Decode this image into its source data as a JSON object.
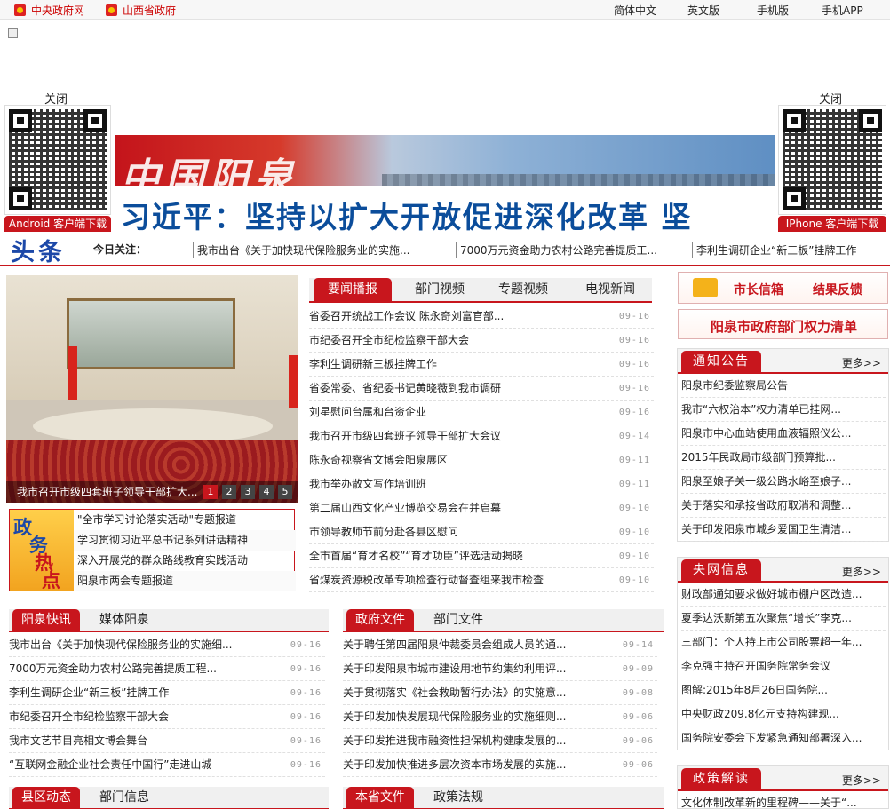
{
  "topbar": {
    "left_links": [
      "中央政府网",
      "山西省政府"
    ],
    "right_links": [
      "简体中文",
      "英文版",
      "手机版",
      "手机APP"
    ]
  },
  "float": {
    "close_left": "关闭",
    "close_right": "关闭",
    "android_label": "Android 客户端下载",
    "iphone_label": "IPhone 客户端下载"
  },
  "banner": {
    "logo": "中国阳泉",
    "headline": "习近平：坚持以扩大开放促进深化改革 坚"
  },
  "ticker": {
    "brand": "头条",
    "today_label": "今日关注：",
    "items": [
      "我市出台《关于加快现代保险服务业的实施...",
      "7000万元资金助力农村公路完善提质工...",
      "李利生调研企业“新三板”挂牌工作"
    ]
  },
  "slider": {
    "caption": "我市召开市级四套班子领导干部扩大...",
    "dots": [
      "1",
      "2",
      "3",
      "4",
      "5"
    ],
    "active": 0
  },
  "hot": {
    "badge": [
      "政",
      "务",
      "热",
      "点"
    ],
    "items": [
      "\"全市学习讨论落实活动\"专题报道",
      "学习贯彻习近平总书记系列讲话精神",
      "深入开展党的群众路线教育实践活动",
      "阳泉市两会专题报道"
    ]
  },
  "news": {
    "tabs": [
      "要闻播报",
      "部门视频",
      "专题视频",
      "电视新闻"
    ],
    "active": 0,
    "items": [
      {
        "title": "省委召开统战工作会议 陈永奇刘富官部...",
        "date": "09-16"
      },
      {
        "title": "市纪委召开全市纪检监察干部大会",
        "date": "09-16"
      },
      {
        "title": "李利生调研新三板挂牌工作",
        "date": "09-16"
      },
      {
        "title": "省委常委、省纪委书记黄晓薇到我市调研",
        "date": "09-16"
      },
      {
        "title": "刘星慰问台属和台资企业",
        "date": "09-16"
      },
      {
        "title": "我市召开市级四套班子领导干部扩大会议",
        "date": "09-14"
      },
      {
        "title": "陈永奇视察省文博会阳泉展区",
        "date": "09-11"
      },
      {
        "title": "我市举办散文写作培训班",
        "date": "09-11"
      },
      {
        "title": "第二届山西文化产业博览交易会在并启幕",
        "date": "09-10"
      },
      {
        "title": "市领导教师节前分赴各县区慰问",
        "date": "09-10"
      },
      {
        "title": "全市首届“育才名校”“育才功臣”评选活动揭晓",
        "date": "09-10"
      },
      {
        "title": "省煤炭资源税改革专项检查行动督查组来我市检查",
        "date": "09-10"
      }
    ]
  },
  "right": {
    "mayor_mail": "市长信箱",
    "feedback": "结果反馈",
    "power_list": "阳泉市政府部门权力清单",
    "more": "更多>>",
    "notice": {
      "title": "通知公告",
      "items": [
        "阳泉市纪委监察局公告",
        "我市“六权治本”权力清单已挂网...",
        "阳泉市中心血站使用血液辐照仪公...",
        "2015年民政局市级部门预算批...",
        "阳泉至娘子关一级公路水峪至娘子...",
        "关于落实和承接省政府取消和调整...",
        "关于印发阳泉市城乡爱国卫生清洁..."
      ]
    },
    "central": {
      "title": "央网信息",
      "items": [
        "财政部通知要求做好城市棚户区改造...",
        "夏季达沃斯第五次聚焦“增长”李克...",
        "三部门：个人持上市公司股票超一年...",
        "李克强主持召开国务院常务会议",
        "图解:2015年8月26日国务院...",
        "中央财政209.8亿元支持构建现...",
        "国务院安委会下发紧急通知部署深入..."
      ]
    },
    "policy": {
      "title": "政策解读",
      "items": [
        "文化体制改革新的里程碑——关于“..."
      ]
    }
  },
  "quick": {
    "tabs": [
      "阳泉快讯",
      "媒体阳泉"
    ],
    "items": [
      {
        "title": "我市出台《关于加快现代保险服务业的实施细...",
        "date": "09-16"
      },
      {
        "title": "7000万元资金助力农村公路完善提质工程...",
        "date": "09-16"
      },
      {
        "title": "李利生调研企业“新三板”挂牌工作",
        "date": "09-16"
      },
      {
        "title": "市纪委召开全市纪检监察干部大会",
        "date": "09-16"
      },
      {
        "title": "我市文艺节目亮相文博会舞台",
        "date": "09-16"
      },
      {
        "title": "“互联网金融企业社会责任中国行”走进山城",
        "date": "09-16"
      }
    ]
  },
  "docs": {
    "tabs": [
      "政府文件",
      "部门文件"
    ],
    "items": [
      {
        "title": "关于聘任第四届阳泉仲裁委员会组成人员的通...",
        "date": "09-14"
      },
      {
        "title": "关于印发阳泉市城市建设用地节约集约利用评...",
        "date": "09-09"
      },
      {
        "title": "关于贯彻落实《社会救助暂行办法》的实施意...",
        "date": "09-08"
      },
      {
        "title": "关于印发加快发展现代保险服务业的实施细则...",
        "date": "09-06"
      },
      {
        "title": "关于印发推进我市融资性担保机构健康发展的...",
        "date": "09-06"
      },
      {
        "title": "关于印发加快推进多层次资本市场发展的实施...",
        "date": "09-06"
      }
    ]
  },
  "county": {
    "tabs": [
      "县区动态",
      "部门信息"
    ]
  },
  "province": {
    "tabs": [
      "本省文件",
      "政策法规"
    ]
  },
  "colors": {
    "brand_red": "#c8161d",
    "link_red": "#cc0000",
    "headline_blue": "#0b4d9b"
  }
}
